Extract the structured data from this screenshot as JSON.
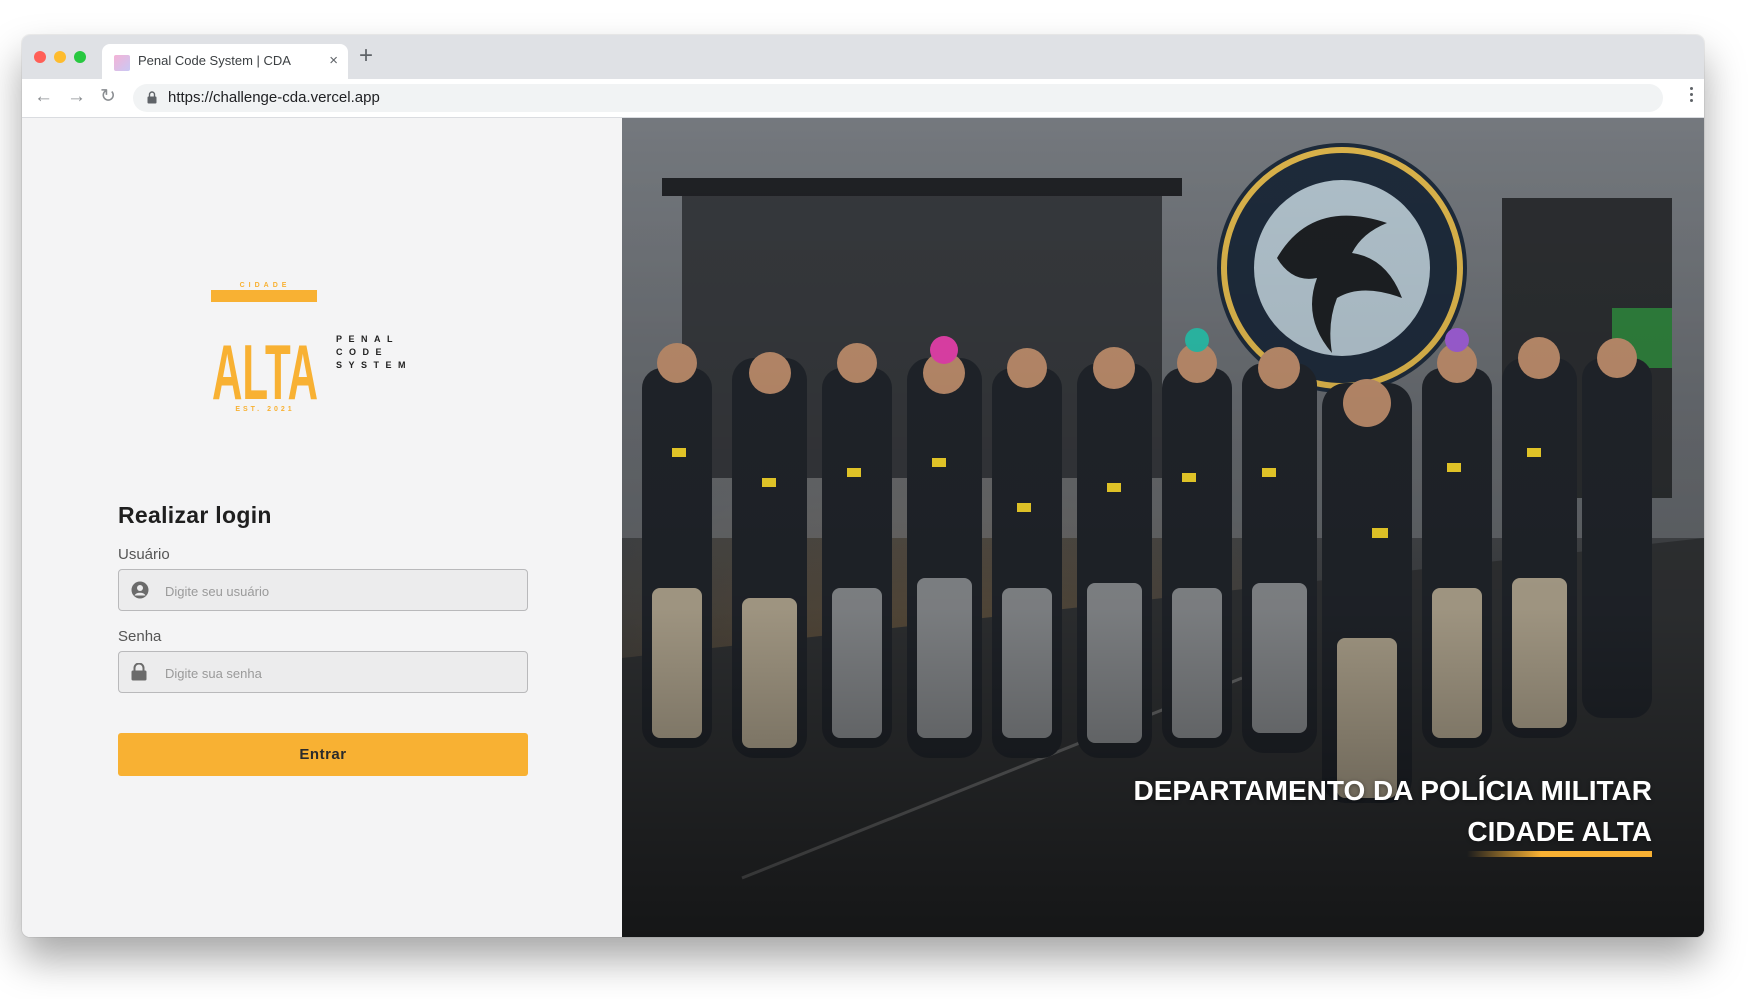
{
  "browser": {
    "tab_title": "Penal Code System | CDA",
    "tab_close": "×",
    "new_tab": "+",
    "url": "https://challenge-cda.vercel.app",
    "icons": [
      "back-arrow-icon",
      "forward-arrow-icon",
      "reload-icon",
      "lock-icon",
      "kebab-menu-icon"
    ]
  },
  "logo": {
    "top_text": "CIDADE",
    "main_text": "ALTA",
    "bottom_text": "EST. 2021",
    "side_text": "PENAL CODE SYSTEM",
    "color": "#f8b133"
  },
  "login": {
    "title": "Realizar login",
    "user_label": "Usuário",
    "user_placeholder": "Digite seu usuário",
    "password_label": "Senha",
    "password_placeholder": "Digite sua senha",
    "submit_label": "Entrar",
    "accent_color": "#f8b133"
  },
  "hero": {
    "line1": "DEPARTAMENTO DA POLÍCIA MILITAR",
    "line2": "CIDADE ALTA",
    "emblem_text": "DEPARTAMENTO DA POLÍCIA MILITAR - CIDADE ALTA"
  }
}
